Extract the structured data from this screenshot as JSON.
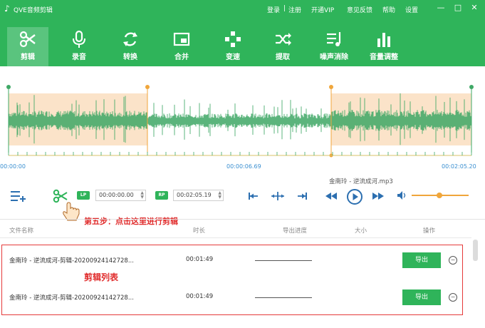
{
  "app": {
    "title": "QVE音频剪辑"
  },
  "titlebar": {
    "login": "登录",
    "sep": "|",
    "register": "注册",
    "vip": "开通VIP",
    "feedback": "意见反馈",
    "help": "帮助",
    "settings": "设置"
  },
  "toolbar": {
    "items": [
      {
        "label": "剪辑",
        "icon": "scissors-icon"
      },
      {
        "label": "录音",
        "icon": "microphone-icon"
      },
      {
        "label": "转换",
        "icon": "convert-icon"
      },
      {
        "label": "合并",
        "icon": "merge-icon"
      },
      {
        "label": "变速",
        "icon": "speed-icon"
      },
      {
        "label": "提取",
        "icon": "extract-icon"
      },
      {
        "label": "噪声消除",
        "icon": "noise-removal-icon"
      },
      {
        "label": "音量调整",
        "icon": "volume-adjust-icon"
      }
    ],
    "active_index": 0
  },
  "timeline": {
    "start": "00:00:00",
    "middle": "00:00:06.69",
    "end": "00:02:05.20"
  },
  "controls": {
    "lp_badge": "LP",
    "lp_time": "00:00:00.00",
    "rp_badge": "RP",
    "rp_time": "00:02:05.19",
    "file_name": "金南玲 - 逆流成河.mp3"
  },
  "annotations": {
    "step_hint": "第五步：点击这里进行剪辑",
    "list_label": "剪辑列表"
  },
  "list": {
    "columns": [
      "文件名称",
      "时长",
      "导出进度",
      "大小",
      "操作"
    ],
    "rows": [
      {
        "name": "金南玲 - 逆流成河-剪辑-20200924142728...",
        "duration": "00:01:49",
        "action": "导出"
      },
      {
        "name": "金南玲 - 逆流成河-剪辑-20200924142728...",
        "duration": "00:01:49",
        "action": "导出"
      }
    ]
  },
  "colors": {
    "brand": "#2fb45a",
    "waveform": "#3fa866",
    "selection": "#fbe3c9",
    "marker": "#f0a63b",
    "annotation": "#e02b2b"
  }
}
